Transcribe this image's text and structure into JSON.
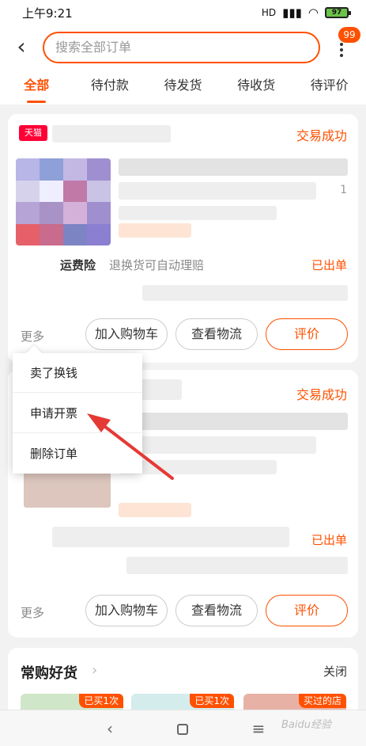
{
  "status_bar": {
    "time": "上午9:21",
    "signal": "HD",
    "battery": "97"
  },
  "header": {
    "back_icon": "chevron-left-icon",
    "search_placeholder": "搜索全部订单",
    "more_icon": "more-vertical-icon",
    "badge_count": "99"
  },
  "tabs": [
    {
      "label": "全部",
      "active": true
    },
    {
      "label": "待付款",
      "active": false
    },
    {
      "label": "待发货",
      "active": false
    },
    {
      "label": "待收货",
      "active": false
    },
    {
      "label": "待评价",
      "active": false
    }
  ],
  "order1": {
    "shop_tag": "天猫",
    "status": "交易成功",
    "quantity": "1",
    "insurance_label": "运费险",
    "insurance_desc": "退换货可自动理赔",
    "insurance_status": "已出单",
    "more": "更多",
    "buttons": {
      "add_cart": "加入购物车",
      "logistics": "查看物流",
      "review": "评价"
    }
  },
  "popup_menu": {
    "items": [
      "卖了换钱",
      "申请开票",
      "删除订单"
    ]
  },
  "order2": {
    "status": "交易成功",
    "insurance_status": "已出单",
    "more": "更多",
    "buttons": {
      "add_cart": "加入购物车",
      "logistics": "查看物流",
      "review": "评价"
    }
  },
  "frequent": {
    "title": "常购好货",
    "close": "关闭",
    "tags": [
      "已买1次",
      "已买1次",
      "买过的店"
    ]
  },
  "watermark": "Baidu经验",
  "colors": {
    "accent": "#ff5000",
    "tmall": "#ff0036",
    "annotation_arrow": "#e53935"
  }
}
